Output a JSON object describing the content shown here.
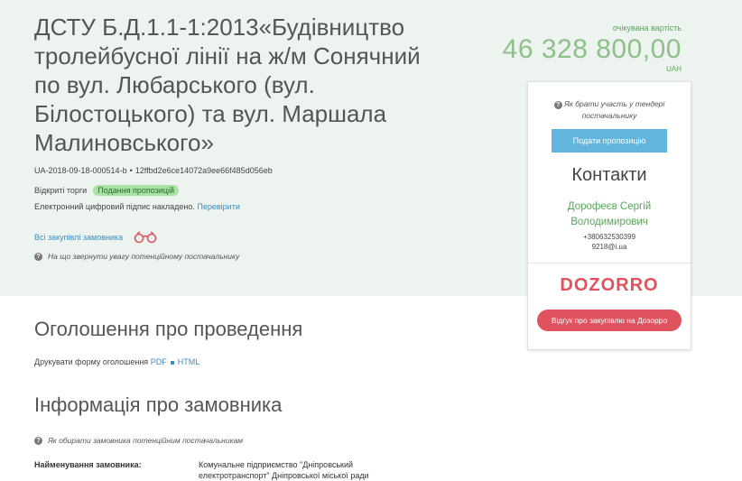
{
  "tender": {
    "title": "ДСТУ Б.Д.1.1-1:2013«Будівництво тролейбусної лінії на ж/м Сонячний по вул. Любарського (вул. Білостоцького) та вул. Маршала Малиновського»",
    "tender_id": "UA-2018-09-18-000514-b",
    "hash": "12ffbd2e6ce14072a9ee66f485d056eb",
    "procedure_type": "Відкриті торги",
    "status_badge": "Подання пропозицій",
    "signature_text": "Електронний цифровий підпис накладено.",
    "verify_link": "Перевірити",
    "all_purchases_link": "Всі закупівлі замовника",
    "supplier_hint": "На що звернути увагу потенційному постачальнику",
    "status_color": "#a9e3a4"
  },
  "price": {
    "label": "очікувана вартість",
    "value": "46 328 800,00",
    "currency": "UAH"
  },
  "sidebar": {
    "participation_hint": "Як брати участь у тендері постачальнику",
    "submit_button": "Подати пропозицію",
    "contacts_title": "Контакти",
    "contact_name": "Дорофеєв Сергій Володимирович",
    "contact_phone": "+380632530399",
    "contact_email": "9218@i.ua",
    "dozorro_logo": "DOZORRO",
    "dozorro_button": "Відгук про закупівлю на Дозорро",
    "accent_color": "#64b5dd",
    "dozorro_color": "#e0535e"
  },
  "announcement": {
    "heading": "Оголошення про проведення",
    "print_text": "Друкувати форму оголошення",
    "pdf_link": "PDF",
    "html_link": "HTML"
  },
  "customer": {
    "heading": "Інформація про замовника",
    "choose_hint": "Як обирати замовника потенційним постачальникам",
    "name_label": "Найменування замовника:",
    "name_value": "Комунальне підприємство \"Дніпровський електротранспорт\" Дніпровської міської ради"
  },
  "icons": {
    "help": "question-circle-icon",
    "binoculars": "binoculars-icon"
  }
}
